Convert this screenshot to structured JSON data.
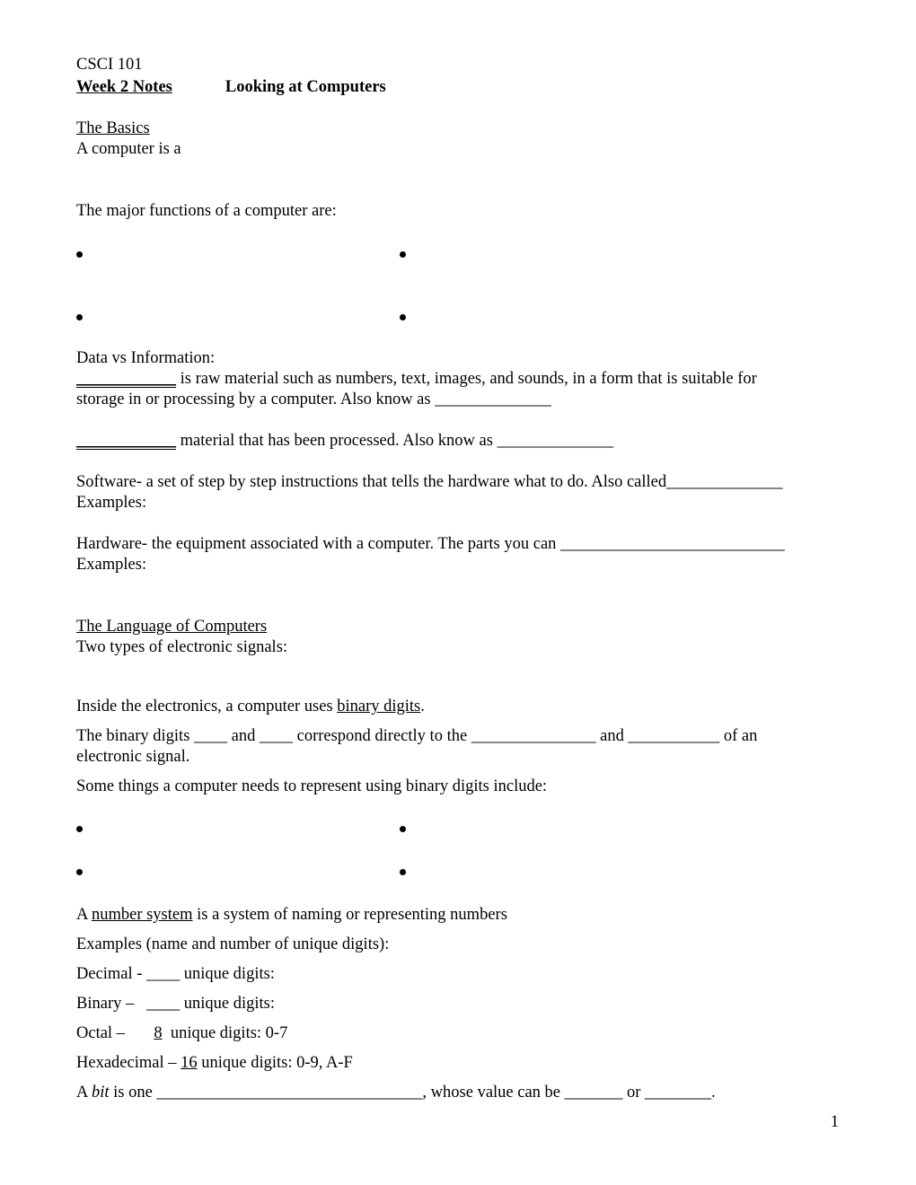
{
  "header": {
    "course": "CSCI 101",
    "week": "Week  2 Notes",
    "title": "Looking at Computers"
  },
  "basics": {
    "heading": "The Basics",
    "definition_prompt": "A computer is a",
    "functions_prompt": "The major functions of a computer are:",
    "bullet_count": 4
  },
  "data_info": {
    "heading": "Data vs Information:",
    "data_blank": "____________",
    "data_line1": " is raw material such as numbers, text, images, and sounds, in a form that is suitable for",
    "data_line2": "storage in or processing by a computer.  Also know as ______________",
    "info_blank": "____________",
    "info_line": " material that has been processed.  Also know as ______________"
  },
  "software": {
    "line1": "Software- a set of step by step instructions that tells the hardware what to do. Also called______________",
    "examples": "Examples:"
  },
  "hardware": {
    "line1": "Hardware- the equipment associated with a computer. The parts you can ___________________________",
    "examples": "Examples:"
  },
  "language": {
    "heading": "The Language of Computers",
    "signals": "Two types of electronic signals:",
    "binary_pre": "Inside the electronics, a computer uses ",
    "binary_term": "binary digits",
    "binary_post": ".",
    "digits_line1": "The binary digits ____ and ____ correspond directly to the _______________ and ___________ of an",
    "digits_line2": "electronic signal.",
    "represent": "Some things a computer needs to represent using binary digits include:",
    "bullet_count": 4
  },
  "number_systems": {
    "def_pre": "A ",
    "def_term": "number system",
    "def_post": " is a system of naming or representing numbers",
    "examples": "Examples (name and number of unique digits):",
    "rows": [
      {
        "name": "Decimal - ",
        "count": "____",
        "rest": " unique digits:"
      },
      {
        "name": "Binary –   ",
        "count": "____",
        "rest": " unique digits:"
      },
      {
        "name": "Octal –       ",
        "count": "8",
        "rest": "  unique digits: 0-7"
      },
      {
        "name": "Hexadecimal – ",
        "count": "16",
        "rest": " unique digits: 0-9, A-F"
      }
    ],
    "bit_pre": "A ",
    "bit_term": "bit",
    "bit_post": " is one ________________________________, whose value can be _______ or ________."
  },
  "page_number": "1"
}
